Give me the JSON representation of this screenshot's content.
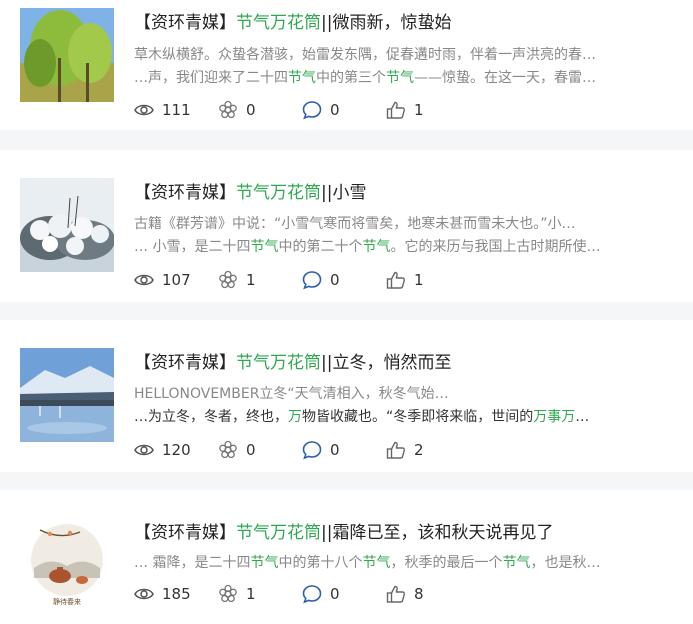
{
  "articles": [
    {
      "title": {
        "prefix": "【资环青媒】",
        "highlight": "节气万花筒",
        "suffix": "||微雨新，惊蛰始"
      },
      "line1": [
        {
          "t": "草木纵横舒。众蛰各潜骇，始雷发东隅，促春遘时雨，伴着一声洪亮的春…",
          "h": false
        }
      ],
      "line2": [
        {
          "t": "…声，我们迎来了二十四",
          "h": false
        },
        {
          "t": "节气",
          "h": true
        },
        {
          "t": "中的第三个",
          "h": false
        },
        {
          "t": "节气",
          "h": true
        },
        {
          "t": "——惊蛰。在这一天，春雷…",
          "h": false
        }
      ],
      "stats": {
        "views": "111",
        "shares": "0",
        "comments": "0",
        "likes": "1"
      }
    },
    {
      "title": {
        "prefix": "【资环青媒】",
        "highlight": "节气万花筒",
        "suffix": "||小雪"
      },
      "line1": [
        {
          "t": "古籍《群芳谱》中说：“小雪气寒而将雪矣，地寒未甚而雪未大也。”小…",
          "h": false
        }
      ],
      "line2": [
        {
          "t": "… 小雪，是二十四",
          "h": false
        },
        {
          "t": "节气",
          "h": true
        },
        {
          "t": "中的第二十个",
          "h": false
        },
        {
          "t": "节气",
          "h": true
        },
        {
          "t": "。它的来历与我国上古时期所使…",
          "h": false
        }
      ],
      "stats": {
        "views": "107",
        "shares": "1",
        "comments": "0",
        "likes": "1"
      }
    },
    {
      "title": {
        "prefix": "【资环青媒】",
        "highlight": "节气万花筒",
        "suffix": "||立冬，悄然而至"
      },
      "line1": [
        {
          "t": "HELLONOVEMBER立冬“天气清相入，秋冬气始…",
          "h": false
        }
      ],
      "line2": [
        {
          "t": "…为立冬，冬者，终也，",
          "h": false
        },
        {
          "t": "万",
          "h": true
        },
        {
          "t": "物皆收藏也。“冬季即将来临，世间的",
          "h": false
        },
        {
          "t": "万事万",
          "h": true
        },
        {
          "t": "…",
          "h": false
        }
      ],
      "stats": {
        "views": "120",
        "shares": "0",
        "comments": "0",
        "likes": "2"
      }
    },
    {
      "title": {
        "prefix": "【资环青媒】",
        "highlight": "节气万花筒",
        "suffix": "||霜降已至，该和秋天说再见了"
      },
      "line1": [
        {
          "t": "… 霜降，是二十四",
          "h": false
        },
        {
          "t": "节气",
          "h": true
        },
        {
          "t": "中的第十八个",
          "h": false
        },
        {
          "t": "节气",
          "h": true
        },
        {
          "t": "，秋季的最后一个",
          "h": false
        },
        {
          "t": "节气",
          "h": true
        },
        {
          "t": "，也是秋…",
          "h": false
        }
      ],
      "line2": [],
      "thumb_caption": "静待春来",
      "stats": {
        "views": "185",
        "shares": "1",
        "comments": "0",
        "likes": "8"
      }
    }
  ],
  "icons": {
    "views": "eye-icon",
    "shares": "share-flower-icon",
    "comments": "comment-bubble-icon",
    "likes": "thumbs-up-icon"
  },
  "colors": {
    "highlight": "#2fa84f",
    "comment_icon": "#2b5fae",
    "muted_text": "#888888",
    "background": "#f5f6f7"
  }
}
